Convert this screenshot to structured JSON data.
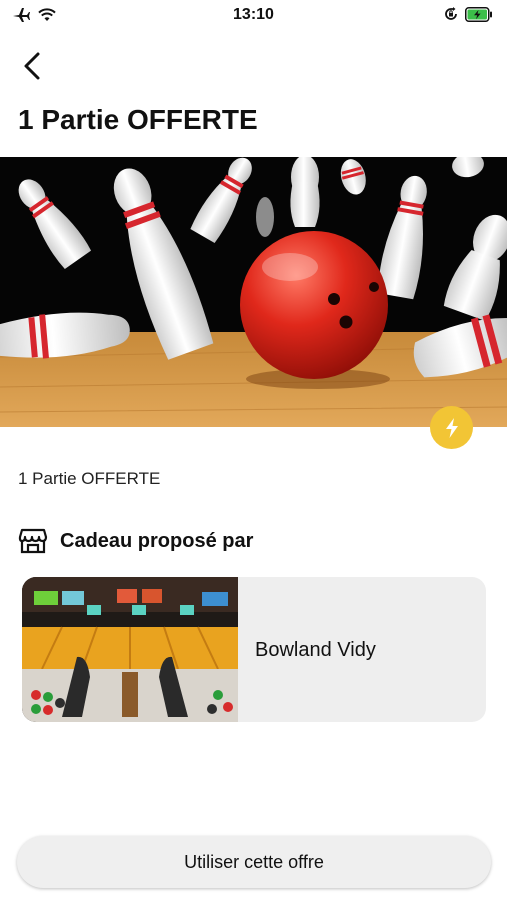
{
  "status_bar": {
    "time": "13:10",
    "icons": [
      "airplane-icon",
      "wifi-icon",
      "orientation-lock-icon",
      "battery-charging-icon"
    ]
  },
  "header": {
    "back_icon": "chevron-left-icon",
    "title": "1 Partie OFFERTE"
  },
  "offer": {
    "hero_image": "bowling-ball-and-pins",
    "badge_icon": "lightning-icon",
    "badge_color": "#f2c535",
    "description": "1 Partie OFFERTE"
  },
  "provider": {
    "section_icon": "store-icon",
    "section_title": "Cadeau proposé par",
    "name": "Bowland Vidy",
    "image": "bowling-alley-lanes"
  },
  "cta": {
    "label": "Utiliser cette offre"
  }
}
